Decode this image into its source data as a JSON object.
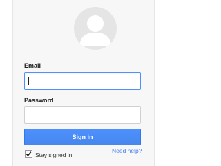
{
  "avatar": {
    "icon": "user-silhouette-icon"
  },
  "form": {
    "email_label": "Email",
    "email_value": "",
    "password_label": "Password",
    "password_value": "",
    "signin_label": "Sign in",
    "stay_signed_in_label": "Stay signed in",
    "stay_signed_in_checked": true,
    "need_help_label": "Need help?"
  },
  "colors": {
    "primary_button": "#4d90fe",
    "focus_border": "#4d90fe",
    "link": "#427fed",
    "card_background": "#f7f7f7"
  }
}
